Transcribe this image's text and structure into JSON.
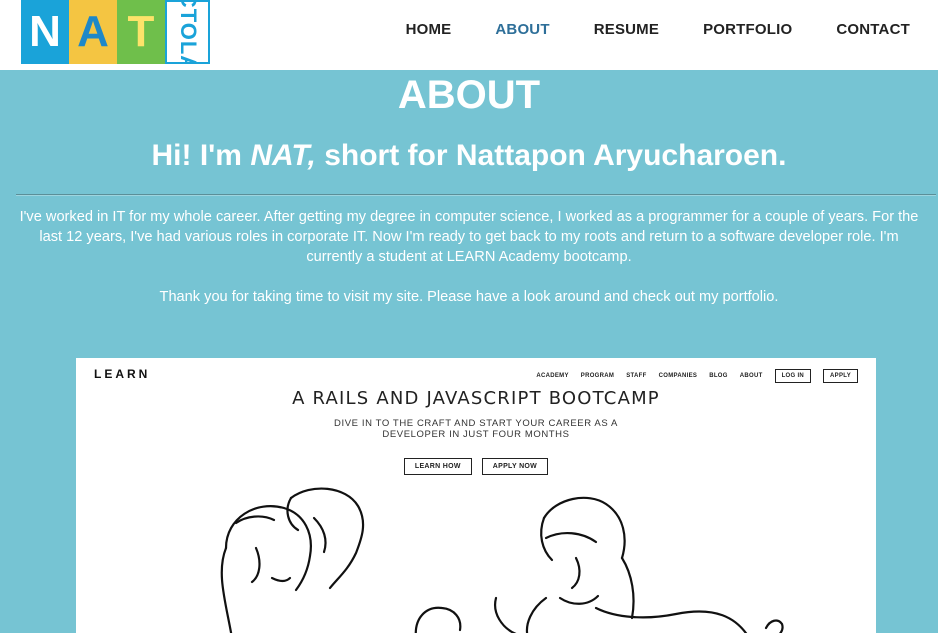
{
  "logo": {
    "letters": [
      "N",
      "A",
      "T"
    ],
    "side_text": "ACTOLAN",
    "alt": "NAT logo"
  },
  "nav": {
    "items": [
      {
        "label": "HOME",
        "active": false
      },
      {
        "label": "ABOUT",
        "active": true
      },
      {
        "label": "RESUME",
        "active": false
      },
      {
        "label": "PORTFOLIO",
        "active": false
      },
      {
        "label": "CONTACT",
        "active": false
      }
    ]
  },
  "about": {
    "title": "ABOUT",
    "intro_prefix": "Hi! I'm ",
    "intro_name": "NAT,",
    "intro_suffix": " short for Nattapon Aryucharoen.",
    "bio": "I've worked in IT for my whole career. After getting my degree in computer science, I worked as a programmer for a couple of years. For the last 12 years, I've had various roles in corporate IT. Now I'm ready to get back to my roots and return to a software developer role. I'm currently a student at LEARN Academy bootcamp.",
    "thanks": "Thank you for taking time to visit my site. Please have a look around and check out my portfolio."
  },
  "preview": {
    "brand": "LEARN",
    "nav": [
      "ACADEMY",
      "PROGRAM",
      "STAFF",
      "COMPANIES",
      "BLOG",
      "ABOUT",
      "LOG IN",
      "APPLY"
    ],
    "headline": "A RAILS AND JAVASCRIPT BOOTCAMP",
    "subline_1": "DIVE IN TO THE CRAFT AND START YOUR CAREER AS A",
    "subline_2": "DEVELOPER IN JUST FOUR MONTHS",
    "learn_how": "LEARN HOW",
    "apply_now": "APPLY NOW"
  },
  "colors": {
    "background": "#76c4d3",
    "nav_active": "#2e6f99",
    "text_light": "#ffffff"
  }
}
